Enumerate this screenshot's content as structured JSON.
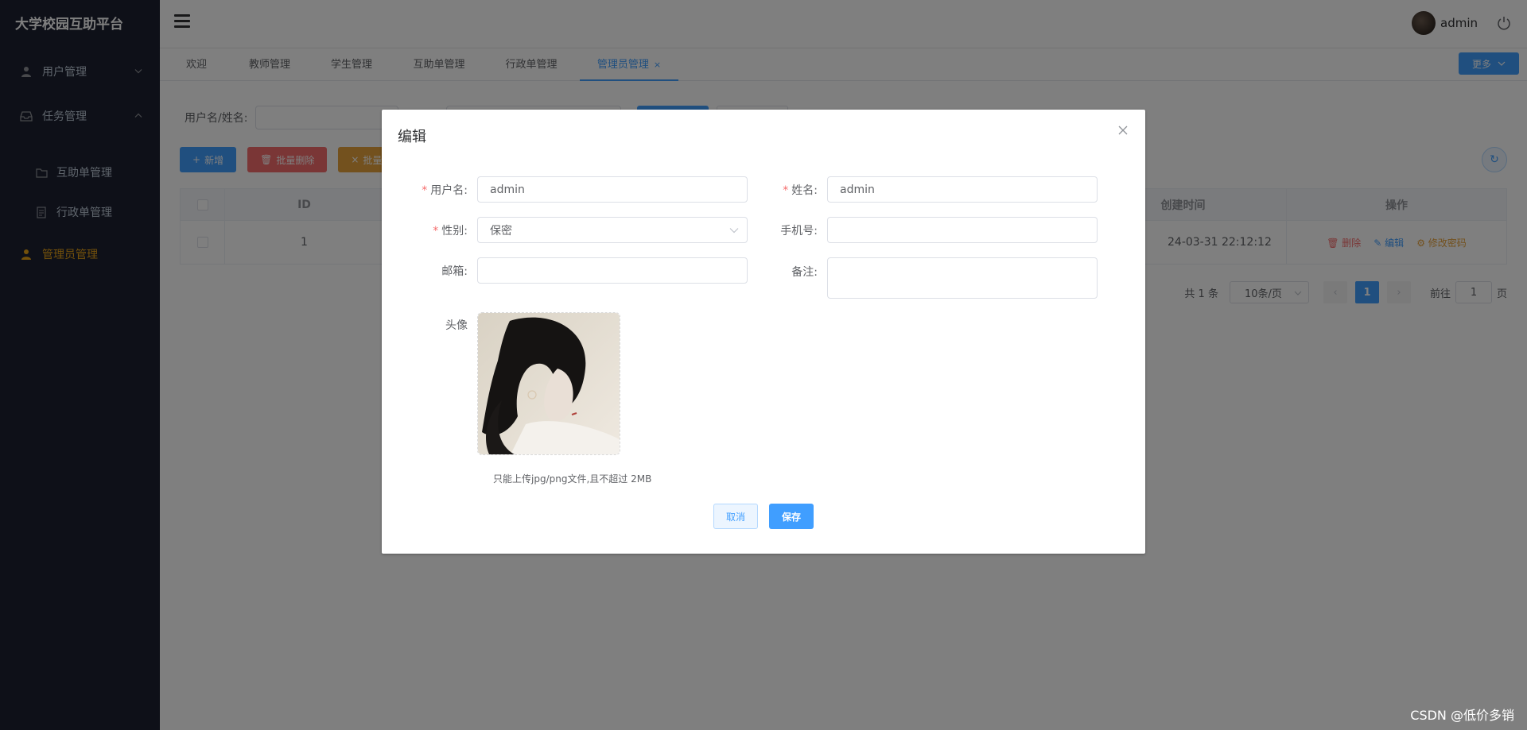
{
  "app": {
    "title": "大学校园互助平台"
  },
  "sidebar": {
    "items": [
      {
        "label": "用户管理",
        "icon": "user-icon",
        "arrow": "chevron-down"
      },
      {
        "label": "任务管理",
        "icon": "inbox-icon",
        "arrow": "chevron-up"
      },
      {
        "label": "互助单管理",
        "icon": "folder-icon"
      },
      {
        "label": "行政单管理",
        "icon": "document-icon"
      },
      {
        "label": "管理员管理",
        "icon": "user-filled-icon",
        "active": true
      }
    ]
  },
  "header": {
    "username": "admin"
  },
  "tabs": {
    "items": [
      {
        "label": "欢迎"
      },
      {
        "label": "教师管理"
      },
      {
        "label": "学生管理"
      },
      {
        "label": "互助单管理"
      },
      {
        "label": "行政单管理"
      },
      {
        "label": "管理员管理",
        "active": true,
        "close": "×"
      }
    ],
    "more_label": "更多"
  },
  "search": {
    "label": "用户名/姓名:"
  },
  "toolbar": {
    "add_label": "新增",
    "batch_delete_label": "批量删除",
    "batch_other_label": "批量"
  },
  "table": {
    "columns": [
      "ID",
      "创建时间",
      "操作"
    ],
    "rows": [
      {
        "id": "1",
        "created": "24-03-31 22:12:12"
      }
    ],
    "ops": {
      "delete": "删除",
      "edit": "编辑",
      "change_pwd": "修改密码"
    }
  },
  "pagination": {
    "total": "共 1 条",
    "page_size": "10条/页",
    "current": "1",
    "goto_label": "前往",
    "goto_value": "1",
    "page_unit": "页"
  },
  "dialog": {
    "title": "编辑",
    "fields": {
      "username": {
        "label": "用户名:",
        "value": "admin",
        "required": "*"
      },
      "name": {
        "label": "姓名:",
        "value": "admin",
        "required": "*"
      },
      "gender": {
        "label": "性别:",
        "value": "保密",
        "required": "*"
      },
      "phone": {
        "label": "手机号:",
        "value": ""
      },
      "email": {
        "label": "邮箱:",
        "value": ""
      },
      "remark": {
        "label": "备注:",
        "value": ""
      },
      "avatar": {
        "label": "头像"
      }
    },
    "upload_tip": "只能上传jpg/png文件,且不超过 2MB",
    "cancel_label": "取消",
    "save_label": "保存"
  },
  "watermark": "CSDN @低价多销",
  "colors": {
    "primary": "#409eff",
    "danger": "#f56c6c",
    "warning": "#e6a23c",
    "sidebar_bg": "#1c2131",
    "active_menu": "#e8a317"
  }
}
